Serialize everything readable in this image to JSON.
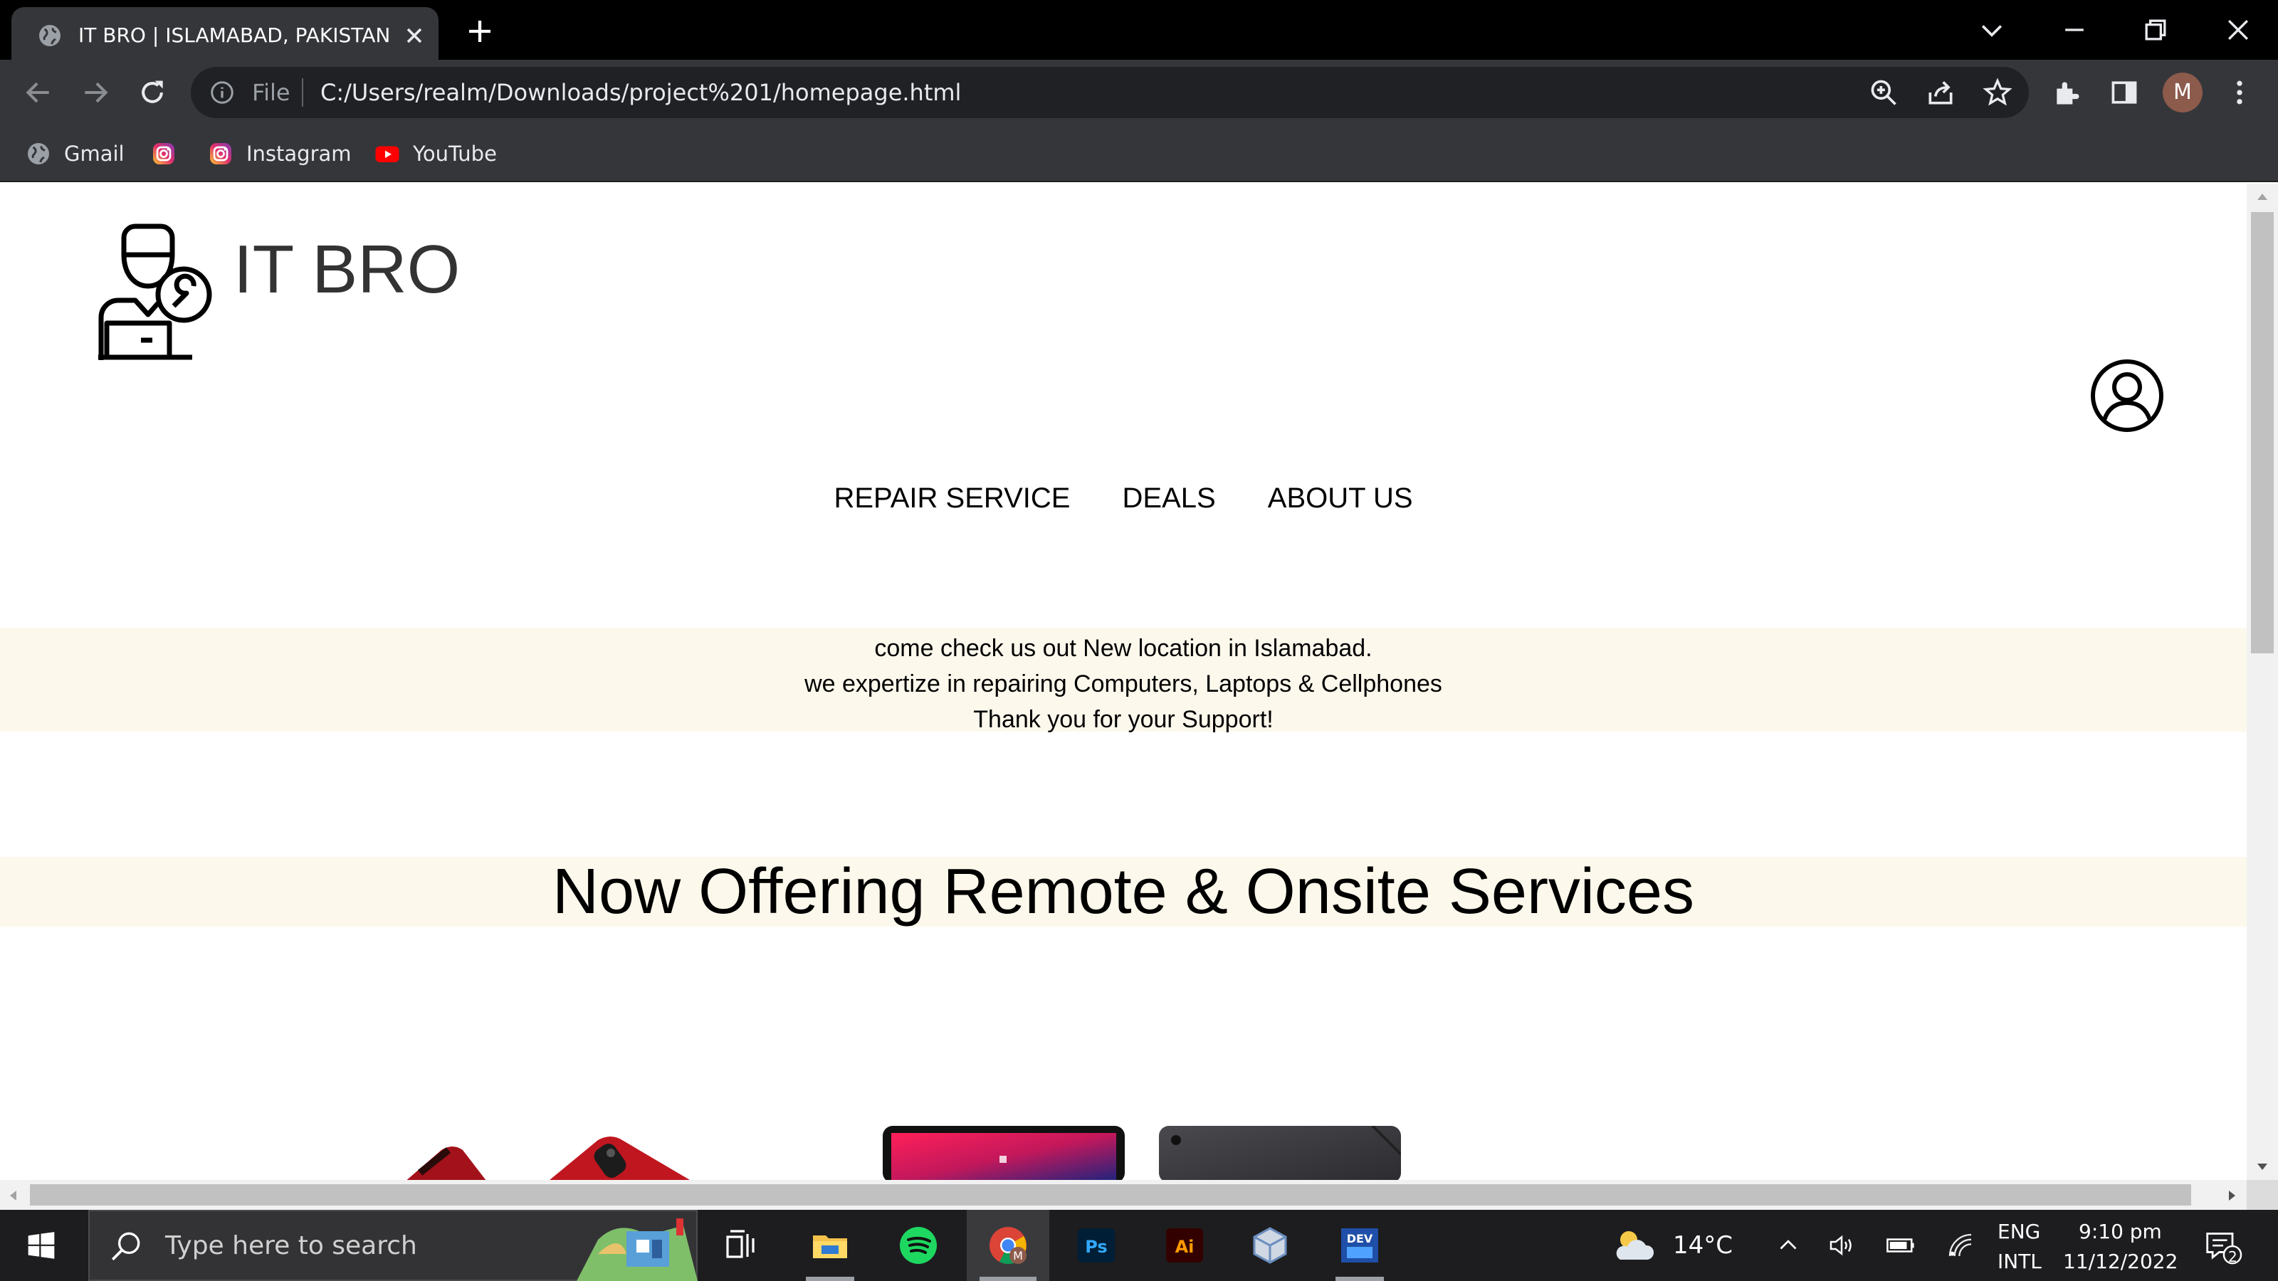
{
  "browser": {
    "tab_title": "IT BRO | ISLAMABAD, PAKISTAN",
    "omnibox_scheme": "File",
    "url": "C:/Users/realm/Downloads/project%201/homepage.html",
    "profile_initial": "M",
    "bookmarks": [
      {
        "label": "Gmail",
        "icon": "globe-icon"
      },
      {
        "label": "",
        "icon": "instagram-icon"
      },
      {
        "label": "Instagram",
        "icon": "instagram-icon"
      },
      {
        "label": "YouTube",
        "icon": "youtube-icon"
      }
    ]
  },
  "page": {
    "brand": "IT BRO",
    "nav": [
      "REPAIR SERVICE",
      "DEALS",
      "ABOUT US"
    ],
    "notice_lines": [
      "come check us out New location in Islamabad.",
      "we expertize in repairing Computers, Laptops & Cellphones",
      "Thank you for your Support!"
    ],
    "offer_heading": "Now Offering Remote & Onsite Services",
    "colors": {
      "band": "#fdf8ec",
      "text": "#000000"
    }
  },
  "taskbar": {
    "search_placeholder": "Type here to search",
    "apps": [
      "task-view",
      "file-explorer",
      "spotify",
      "chrome",
      "photoshop",
      "illustrator",
      "virtualbox",
      "dev-cpp"
    ],
    "weather": "14°C",
    "lang_top": "ENG",
    "lang_bottom": "INTL",
    "time": "9:10 pm",
    "date": "11/12/2022",
    "notification_count": "2"
  }
}
